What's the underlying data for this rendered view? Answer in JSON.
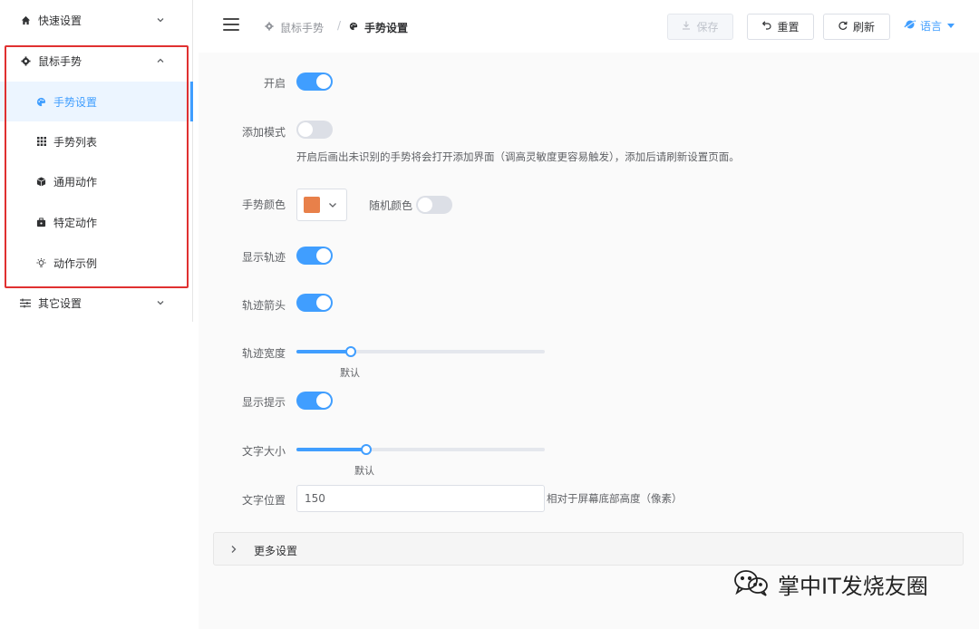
{
  "sidebar": {
    "items": [
      {
        "label": "快速设置",
        "icon": "home-icon"
      },
      {
        "label": "鼠标手势",
        "icon": "gear-icon"
      },
      {
        "label": "其它设置",
        "icon": "sliders-icon"
      }
    ],
    "sub_items": [
      {
        "label": "手势设置",
        "icon": "palette-icon",
        "active": true
      },
      {
        "label": "手势列表",
        "icon": "grid-icon"
      },
      {
        "label": "通用动作",
        "icon": "cube-icon"
      },
      {
        "label": "特定动作",
        "icon": "briefcase-icon"
      },
      {
        "label": "动作示例",
        "icon": "bulb-icon"
      }
    ],
    "highlight_color": "#e03030",
    "active_color": "#409eff"
  },
  "header": {
    "breadcrumb": [
      "鼠标手势",
      "手势设置"
    ],
    "breadcrumb_sep": "/",
    "save_label": "保存",
    "reset_label": "重置",
    "refresh_label": "刷新",
    "language_label": "语言"
  },
  "form": {
    "enable_label": "开启",
    "enable_on": true,
    "add_mode_label": "添加模式",
    "add_mode_on": false,
    "add_mode_hint": "开启后画出未识别的手势将会打开添加界面（调高灵敏度更容易触发），添加后请刷新设置页面。",
    "gesture_color_label": "手势颜色",
    "gesture_color": "#e8804a",
    "random_color_label": "随机颜色",
    "random_color_on": false,
    "show_trail_label": "显示轨迹",
    "show_trail_on": true,
    "trail_arrow_label": "轨迹箭头",
    "trail_arrow_on": true,
    "trail_width_label": "轨迹宽度",
    "trail_width_value": "默认",
    "trail_width_fraction": 0.22,
    "show_tip_label": "显示提示",
    "show_tip_on": true,
    "text_size_label": "文字大小",
    "text_size_value": "默认",
    "text_size_fraction": 0.28,
    "text_position_label": "文字位置",
    "text_position_value": "150",
    "text_position_hint": "相对于屏幕底部高度（像素）",
    "more_settings_label": "更多设置"
  },
  "watermark": {
    "text": "掌中IT发烧友圈",
    "icon": "wechat-icon"
  }
}
